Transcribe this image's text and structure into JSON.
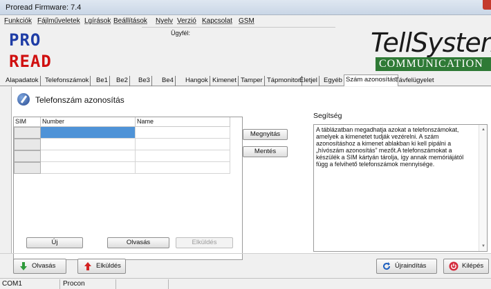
{
  "window": {
    "title": "Proread Firmware: 7.4"
  },
  "menu": [
    "Funkciók",
    "Fájlműveletek",
    "Lgírások",
    "Beállítások",
    "Nyelv",
    "Verzió",
    "Kapcsolat",
    "GSM"
  ],
  "header": {
    "client_label": "Ügyfél:",
    "logo_line1": "PRO",
    "logo_line2": "READ",
    "brand_name": "TellSystem",
    "brand_sub": "COMMUNICATION"
  },
  "tabs": [
    "Alapadatok",
    "Telefonszámok",
    "Be1",
    "Be2",
    "Be3",
    "Be4",
    "Hangok",
    "Kimenet",
    "Tamper",
    "Tápmonitor",
    "Életjel",
    "Egyéb",
    "Szám azonosítás",
    "Távfelügyelet"
  ],
  "active_tab": "Szám azonosítás",
  "panel": {
    "title": "Telefonszám azonosítás",
    "table": {
      "headers": [
        "SIM",
        "Number",
        "Name"
      ],
      "rows": [
        [
          "",
          "",
          ""
        ],
        [
          "",
          "",
          ""
        ],
        [
          "",
          "",
          ""
        ],
        [
          "",
          "",
          ""
        ]
      ]
    },
    "buttons": {
      "open": "Megnyitás",
      "save": "Mentés",
      "new": "Új",
      "read": "Olvasás",
      "send": "Elküldés"
    },
    "help": {
      "label": "Segítség",
      "text": "A táblázatban megadhatja azokat a telefonszámokat, amelyek a kimenetet tudják vezérelni. A szám azonosításhoz a kimenet ablakban ki kell pipálni a „hívószám azonosítás” mezőt.A telefonszámokat a készülék a SIM kártyán tárolja, így annak memóriájától függ a felvihető telefonszámok mennyisége."
    }
  },
  "bottom": {
    "read": "Olvasás",
    "send": "Elküldés",
    "restart": "Újraindítás",
    "exit": "Kilépés"
  },
  "status": {
    "port": "COM1",
    "device": "Procon"
  },
  "colors": {
    "accent_green": "#2f7a36",
    "selection_blue": "#4f93d7",
    "logo_blue": "#1f3da6",
    "logo_red": "#d01010"
  }
}
